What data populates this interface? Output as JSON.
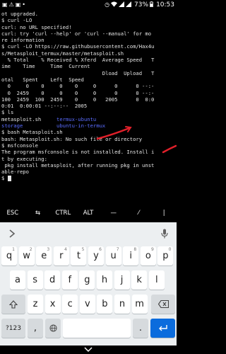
{
  "status_bar": {
    "left_icons": [
      "image-icon",
      "warning-icon",
      "image-icon",
      "notification-dot-icon"
    ],
    "battery": "73%",
    "time": "10:53"
  },
  "terminal": {
    "lines": [
      "ot upgraded.",
      "$ curl -LO",
      "curl: no URL specified!",
      "curl: try 'curl --help' or 'curl --manual' for mo",
      "re information",
      "$ curl -LO https://raw.githubusercontent.com/Hax4u",
      "s/Metasploit_termux/master/metasploit.sh",
      "  % Total    % Received % Xferd  Average Speed   T",
      "ime    Time     Time  Current",
      "                                 Dload  Upload   T",
      "otal   Spent    Left  Speed",
      "  0     0    0     0    0     0      0      0 --:-",
      "  0  2459    0     0    0     0      0      0 --:-",
      "100  2459  100  2459    0     0   2005      0  0:0",
      "0:01  0:00:01 --:--:--  2005",
      "$ ls"
    ],
    "ls_rows": [
      [
        "metasploit.sh",
        "termux-ubuntu"
      ],
      [
        "storage",
        "ubuntu-in-termux"
      ]
    ],
    "lines_after": [
      "$ bash Metasploit.sh",
      "bash: Metasploit.sh: No such file or directory",
      "$ msfconsole",
      "The program msfconsole is not installed. Install i",
      "t by executing:",
      " pkg install metasploit, after running pkg in unst",
      "able-repo",
      "$ "
    ]
  },
  "extra_keys": [
    "ESC",
    "⇆",
    "CTRL",
    "ALT",
    "—",
    "⁄",
    "|"
  ],
  "keyboard": {
    "row1": [
      [
        "q",
        "1"
      ],
      [
        "w",
        "2"
      ],
      [
        "e",
        "3"
      ],
      [
        "r",
        "4"
      ],
      [
        "t",
        "5"
      ],
      [
        "y",
        "6"
      ],
      [
        "u",
        "7"
      ],
      [
        "i",
        "8"
      ],
      [
        "o",
        "9"
      ],
      [
        "p",
        "0"
      ]
    ],
    "row2": [
      "a",
      "s",
      "d",
      "f",
      "g",
      "h",
      "j",
      "k",
      "l"
    ],
    "row3": [
      "z",
      "x",
      "c",
      "v",
      "b",
      "n",
      "m"
    ],
    "bottom": {
      "symbols": "?123",
      "comma": ",",
      "period": "."
    }
  },
  "colors": {
    "terminal_bg": "#000000",
    "terminal_text": "#e6e6e6",
    "directory": "#5a6cff",
    "annotation": "#e0202a",
    "keyboard_bg": "#eceff1",
    "enter_key": "#0b6cdd"
  }
}
